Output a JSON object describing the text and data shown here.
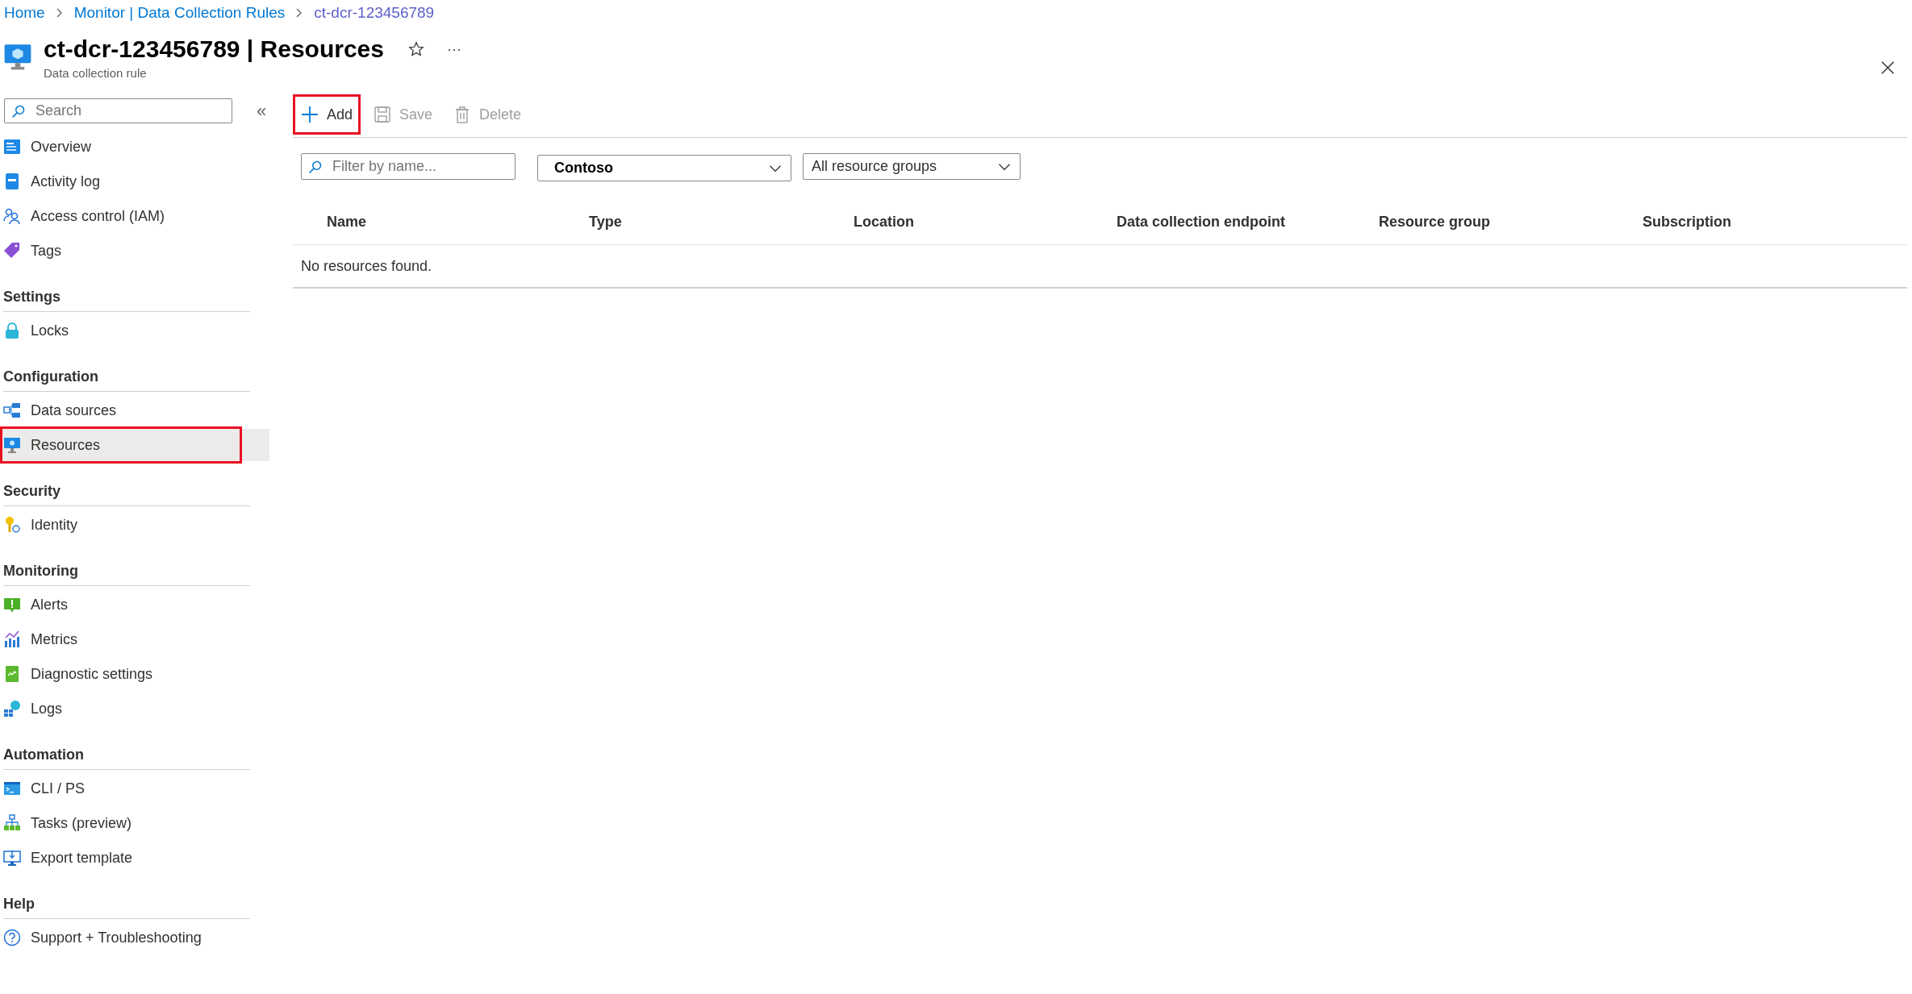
{
  "breadcrumb": [
    {
      "label": "Home",
      "current": false
    },
    {
      "label": "Monitor | Data Collection Rules",
      "current": false
    },
    {
      "label": "ct-dcr-123456789",
      "current": true
    }
  ],
  "header": {
    "title": "ct-dcr-123456789 | Resources",
    "subtitle": "Data collection rule",
    "more": "···"
  },
  "sidebar": {
    "search": {
      "placeholder": "Search"
    },
    "collapse": "«",
    "sections": [
      {
        "items": [
          {
            "label": "Overview",
            "selected": false,
            "highlighted": false
          },
          {
            "label": "Activity log",
            "selected": false,
            "highlighted": false
          },
          {
            "label": "Access control (IAM)",
            "selected": false,
            "highlighted": false
          },
          {
            "label": "Tags",
            "selected": false,
            "highlighted": false
          }
        ]
      },
      {
        "title": "Settings",
        "items": [
          {
            "label": "Locks",
            "selected": false,
            "highlighted": false
          }
        ]
      },
      {
        "title": "Configuration",
        "items": [
          {
            "label": "Data sources",
            "selected": false,
            "highlighted": false
          },
          {
            "label": "Resources",
            "selected": true,
            "highlighted": true
          }
        ]
      },
      {
        "title": "Security",
        "items": [
          {
            "label": "Identity",
            "selected": false,
            "highlighted": false
          }
        ]
      },
      {
        "title": "Monitoring",
        "items": [
          {
            "label": "Alerts",
            "selected": false,
            "highlighted": false
          },
          {
            "label": "Metrics",
            "selected": false,
            "highlighted": false
          },
          {
            "label": "Diagnostic settings",
            "selected": false,
            "highlighted": false
          },
          {
            "label": "Logs",
            "selected": false,
            "highlighted": false
          }
        ]
      },
      {
        "title": "Automation",
        "items": [
          {
            "label": "CLI / PS",
            "selected": false,
            "highlighted": false
          },
          {
            "label": "Tasks (preview)",
            "selected": false,
            "highlighted": false
          },
          {
            "label": "Export template",
            "selected": false,
            "highlighted": false
          }
        ]
      },
      {
        "title": "Help",
        "items": [
          {
            "label": "Support + Troubleshooting",
            "selected": false,
            "highlighted": false
          }
        ]
      }
    ]
  },
  "toolbar": [
    {
      "kind": "add",
      "label": "Add",
      "disabled": false,
      "highlighted": true
    },
    {
      "kind": "save",
      "label": "Save",
      "disabled": true,
      "highlighted": false
    },
    {
      "kind": "delete",
      "label": "Delete",
      "disabled": true,
      "highlighted": false
    }
  ],
  "filters": {
    "search": {
      "placeholder": "Filter by name..."
    },
    "subscription": {
      "value": "Contoso"
    },
    "resource_group": {
      "value": "All resource groups"
    }
  },
  "table": {
    "columns": [
      "Name",
      "Type",
      "Location",
      "Data collection endpoint",
      "Resource group",
      "Subscription"
    ],
    "empty_message": "No resources found."
  }
}
